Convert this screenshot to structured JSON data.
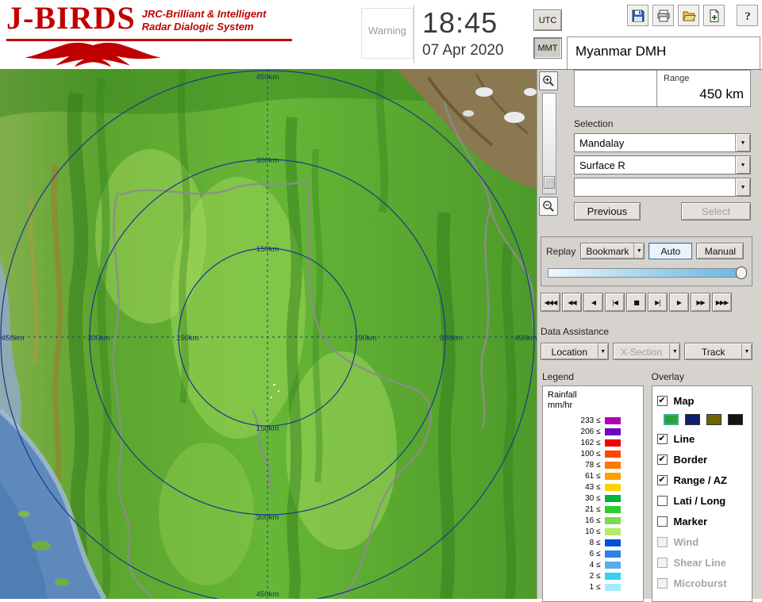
{
  "header": {
    "logo": {
      "title": "J-BIRDS",
      "tagline1": "JRC-Brilliant & Intelligent",
      "tagline2": "Radar  Dialogic  System"
    },
    "warning_label": "Warning",
    "clock": {
      "time": "18:45",
      "date": "07 Apr 2020"
    },
    "timezone_buttons": [
      {
        "label": "UTC",
        "active": false
      },
      {
        "label": "MMT",
        "active": true
      }
    ],
    "station": "Myanmar DMH",
    "toolbar_icons": [
      "save-icon",
      "print-icon",
      "open-icon",
      "export-icon",
      "help-icon"
    ]
  },
  "map": {
    "ring_labels": {
      "r150": "150km",
      "r300": "300km",
      "r450": "450km"
    }
  },
  "panel": {
    "range": {
      "label": "Range",
      "value": "450 km"
    },
    "selection": {
      "label": "Selection",
      "dropdowns": [
        {
          "value": "Mandalay"
        },
        {
          "value": "Surface R"
        },
        {
          "value": ""
        }
      ],
      "previous_button": "Previous",
      "select_button": "Select"
    },
    "replay": {
      "label": "Replay",
      "bookmark_button": "Bookmark",
      "auto_button": "Auto",
      "manual_button": "Manual",
      "playback_buttons": [
        {
          "name": "rewind-full",
          "symbol": "◀◀◀"
        },
        {
          "name": "rewind",
          "symbol": "◀◀"
        },
        {
          "name": "play-reverse",
          "symbol": "◀"
        },
        {
          "name": "step-back",
          "symbol": "|◀"
        },
        {
          "name": "stop",
          "symbol": "■"
        },
        {
          "name": "step-forward",
          "symbol": "▶|"
        },
        {
          "name": "play",
          "symbol": "▶"
        },
        {
          "name": "fast-forward",
          "symbol": "▶▶"
        },
        {
          "name": "fast-forward-full",
          "symbol": "▶▶▶"
        }
      ]
    },
    "data_assistance": {
      "label": "Data Assistance",
      "buttons": [
        {
          "label": "Location",
          "disabled": false
        },
        {
          "label": "X-Section",
          "disabled": true
        },
        {
          "label": "Track",
          "disabled": false
        }
      ]
    },
    "legend": {
      "label": "Legend",
      "title_line1": "Rainfall",
      "title_line2": "mm/hr",
      "entries": [
        {
          "value": "233 ≤",
          "color": "#b400b4"
        },
        {
          "value": "206 ≤",
          "color": "#6e00c8"
        },
        {
          "value": "162 ≤",
          "color": "#f00000"
        },
        {
          "value": "100 ≤",
          "color": "#ff4600"
        },
        {
          "value": "78 ≤",
          "color": "#ff7800"
        },
        {
          "value": "61 ≤",
          "color": "#ffa000"
        },
        {
          "value": "43 ≤",
          "color": "#ffd200"
        },
        {
          "value": "30 ≤",
          "color": "#00b43c"
        },
        {
          "value": "21 ≤",
          "color": "#2dcd2d"
        },
        {
          "value": "16 ≤",
          "color": "#78dc50"
        },
        {
          "value": "10 ≤",
          "color": "#b4eb64"
        },
        {
          "value": "8 ≤",
          "color": "#0050dc"
        },
        {
          "value": "6 ≤",
          "color": "#2d82e6"
        },
        {
          "value": "4 ≤",
          "color": "#5aaaf0"
        },
        {
          "value": "2 ≤",
          "color": "#32d2f0"
        },
        {
          "value": "1 ≤",
          "color": "#a0ebfa"
        }
      ]
    },
    "overlay": {
      "label": "Overlay",
      "items": [
        {
          "label": "Map",
          "checked": true,
          "disabled": false,
          "swatches": [
            {
              "color": "#2f9e3c",
              "selected": true
            },
            {
              "color": "#10206e",
              "selected": false
            },
            {
              "color": "#6e6400",
              "selected": false
            },
            {
              "color": "#141414",
              "selected": false
            }
          ]
        },
        {
          "label": "Line",
          "checked": true,
          "disabled": false
        },
        {
          "label": "Border",
          "checked": true,
          "disabled": false
        },
        {
          "label": "Range / AZ",
          "checked": true,
          "disabled": false
        },
        {
          "label": "Lati / Long",
          "checked": false,
          "disabled": false
        },
        {
          "label": "Marker",
          "checked": false,
          "disabled": false
        },
        {
          "label": "Wind",
          "checked": false,
          "disabled": true
        },
        {
          "label": "Shear Line",
          "checked": false,
          "disabled": true
        },
        {
          "label": "Microburst",
          "checked": false,
          "disabled": true
        }
      ]
    }
  }
}
